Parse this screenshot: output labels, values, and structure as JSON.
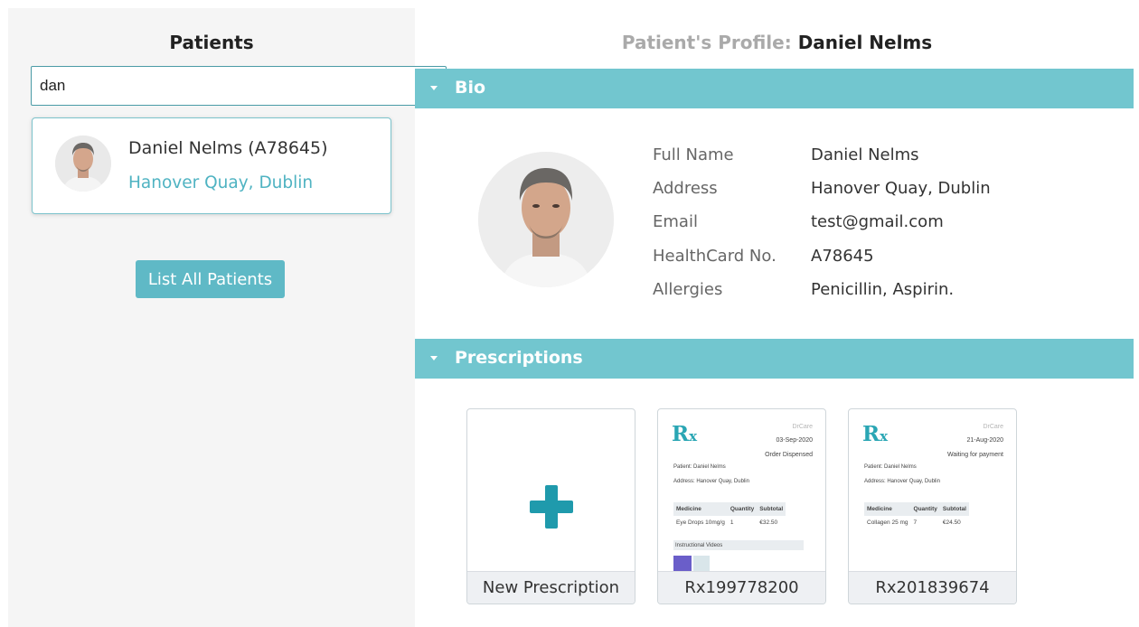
{
  "left": {
    "title": "Patients",
    "search": {
      "value": "dan",
      "placeholder": ""
    },
    "result": {
      "name_line": "Daniel Nelms (A78645)",
      "address": "Hanover Quay, Dublin"
    },
    "list_all_label": "List All Patients"
  },
  "profile": {
    "title_prefix": "Patient's Profile:",
    "title_name": "Daniel Nelms",
    "bio_section_label": "Bio",
    "prescriptions_section_label": "Prescriptions",
    "bio": {
      "full_name_label": "Full Name",
      "full_name": "Daniel Nelms",
      "address_label": "Address",
      "address": "Hanover Quay, Dublin",
      "email_label": "Email",
      "email": "test@gmail.com",
      "healthcard_label": "HealthCard No.",
      "healthcard": "A78645",
      "allergies_label": "Allergies",
      "allergies": "Penicillin,  Aspirin."
    }
  },
  "prescriptions": {
    "new_label": "New Prescription",
    "items": [
      {
        "id": "Rx199778200",
        "brand": "DrCare",
        "date": "03-Sep-2020",
        "status": "Order Dispensed",
        "patient": "Patient: Daniel Nelms",
        "address": "Address: Hanover Quay, Dublin",
        "headers": [
          "Medicine",
          "Quantity",
          "Subtotal"
        ],
        "rows": [
          [
            "Eye Drops 10mg/g",
            "1",
            "€32.50"
          ]
        ],
        "videos_label": "Instructional Videos"
      },
      {
        "id": "Rx201839674",
        "brand": "DrCare",
        "date": "21-Aug-2020",
        "status": "Waiting for payment",
        "patient": "Patient: Daniel Nelms",
        "address": "Address: Hanover Quay, Dublin",
        "headers": [
          "Medicine",
          "Quantity",
          "Subtotal"
        ],
        "rows": [
          [
            "Collagen 25 mg",
            "7",
            "€24.50"
          ]
        ]
      }
    ]
  },
  "colors": {
    "accent": "#72c6cf",
    "button": "#5fb9c6",
    "link_text": "#4fb3c2",
    "plus": "#1f9aac"
  },
  "icons": {
    "section_toggle": "caret-down-icon",
    "new_prescription": "plus-icon",
    "rx_logo": "rx-icon"
  }
}
